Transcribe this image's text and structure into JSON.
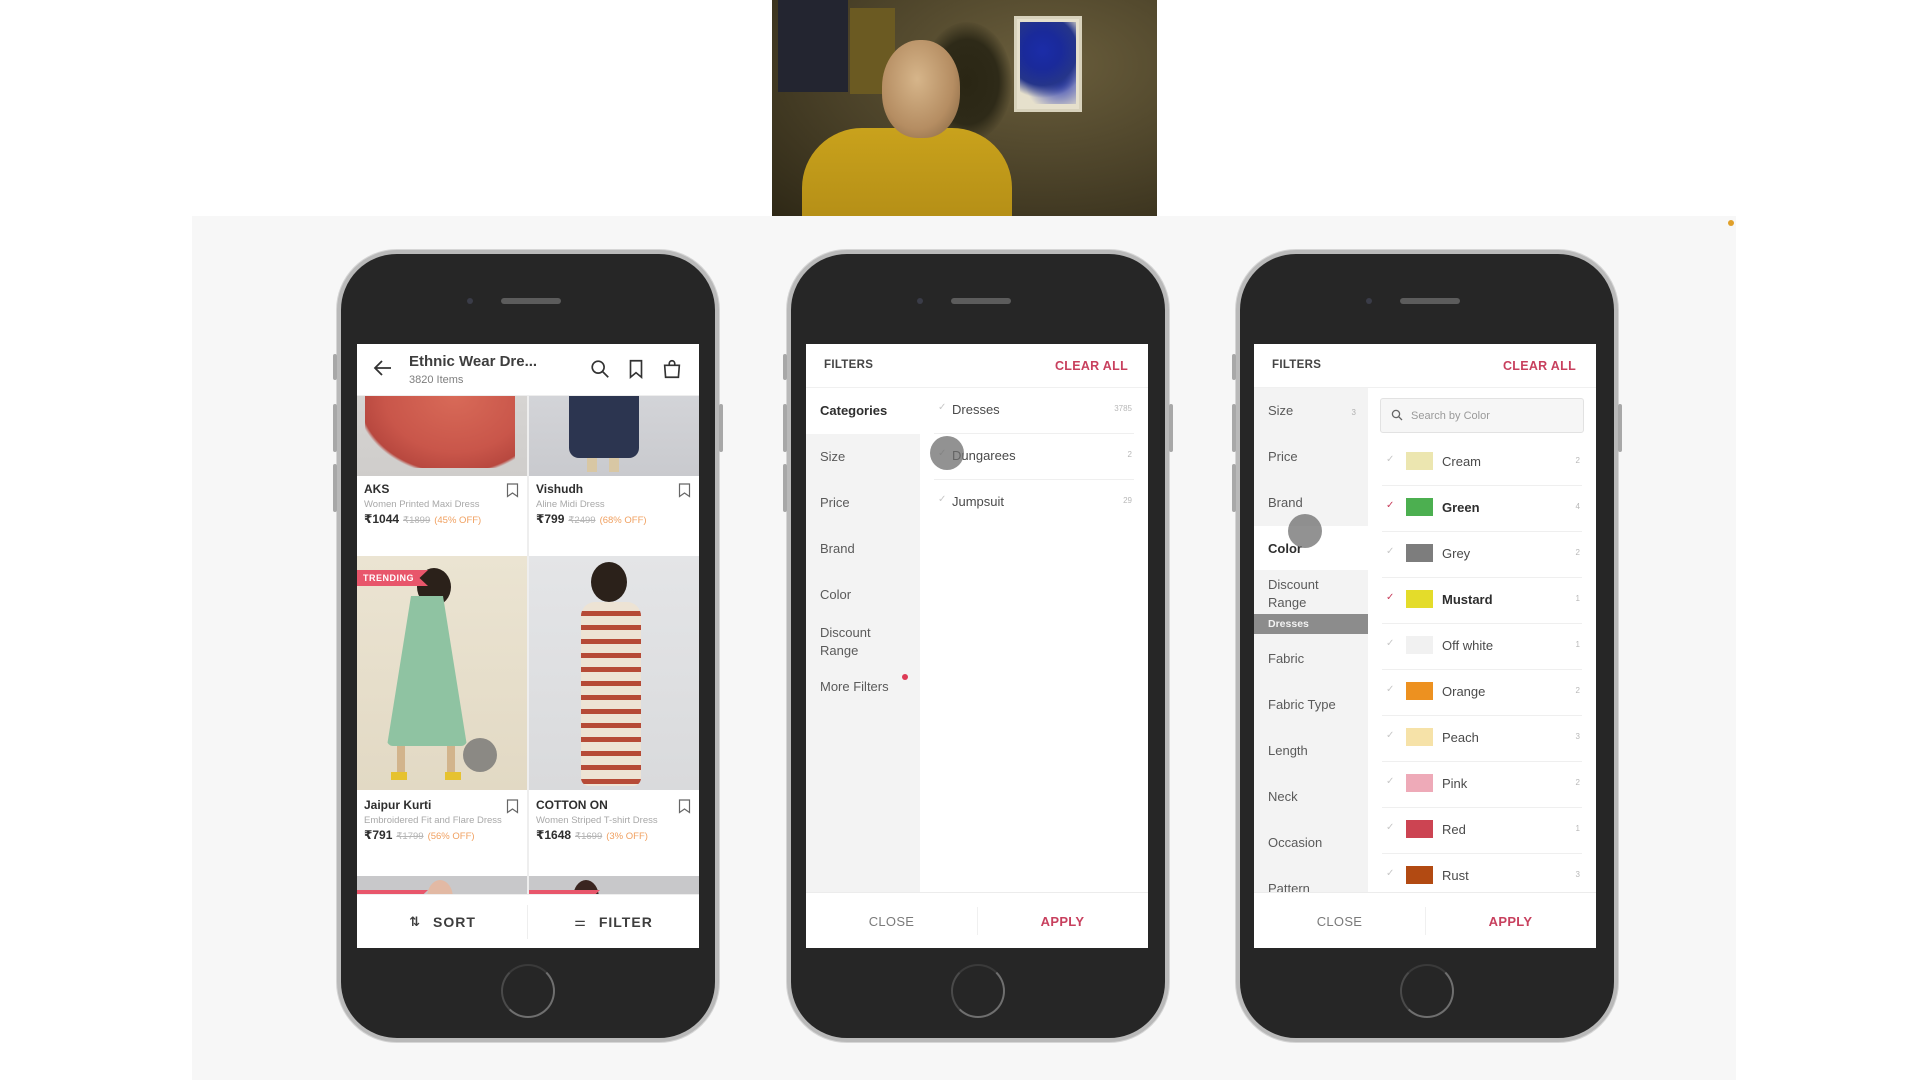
{
  "webcam": {
    "description": "presenter webcam feed"
  },
  "phone1": {
    "header": {
      "back_icon": "arrow-left-icon",
      "title": "Ethnic Wear Dre...",
      "subtitle": "3820 Items",
      "icons": [
        "search-icon",
        "bookmark-icon",
        "shopping-bag-icon"
      ]
    },
    "products": [
      {
        "brand": "AKS",
        "description": "Women Printed Maxi Dress",
        "price": "₹1044",
        "mrp": "₹1899",
        "discount": "(45% OFF)",
        "trending": false,
        "image_colors": [
          "#c9564a",
          "#d7d4d2"
        ]
      },
      {
        "brand": "Vishudh",
        "description": "Aline Midi Dress",
        "price": "₹799",
        "mrp": "₹2499",
        "discount": "(68% OFF)",
        "trending": false,
        "image_colors": [
          "#2c3550",
          "#cfcfd1"
        ]
      },
      {
        "brand": "Jaipur Kurti",
        "description": "Embroidered Fit and Flare Dress",
        "price": "₹791",
        "mrp": "₹1799",
        "discount": "(56% OFF)",
        "trending": true,
        "image_colors": [
          "#8fc3a2",
          "#e9e1cf"
        ]
      },
      {
        "brand": "COTTON ON",
        "description": "Women Striped T-shirt Dress",
        "price": "₹1648",
        "mrp": "₹1699",
        "discount": "(3% OFF)",
        "trending": false,
        "image_colors": [
          "#b64a36",
          "#ece3d6"
        ]
      }
    ],
    "trending_label": "TRENDING",
    "footer": {
      "sort_label": "SORT",
      "filter_label": "FILTER"
    }
  },
  "phone2": {
    "title": "FILTERS",
    "clear_all": "CLEAR ALL",
    "categories": [
      {
        "label": "Categories",
        "active": true
      },
      {
        "label": "Size"
      },
      {
        "label": "Price"
      },
      {
        "label": "Brand"
      },
      {
        "label": "Color"
      },
      {
        "label": "Discount Range"
      },
      {
        "label": "More Filters",
        "indicator": true
      }
    ],
    "options": [
      {
        "label": "Dresses",
        "count": "3785"
      },
      {
        "label": "Dungarees",
        "count": "2"
      },
      {
        "label": "Jumpsuit",
        "count": "29"
      }
    ],
    "close_label": "CLOSE",
    "apply_label": "APPLY"
  },
  "phone3": {
    "title": "FILTERS",
    "clear_all": "CLEAR ALL",
    "categories": [
      {
        "label": "Size",
        "count": "3"
      },
      {
        "label": "Price"
      },
      {
        "label": "Brand"
      },
      {
        "label": "Color",
        "active": true
      },
      {
        "label": "Discount Range"
      },
      {
        "label": "Fabric"
      },
      {
        "label": "Fabric Type"
      },
      {
        "label": "Length"
      },
      {
        "label": "Neck"
      },
      {
        "label": "Occasion"
      },
      {
        "label": "Pattern"
      }
    ],
    "section_tag": "Dresses",
    "search_placeholder": "Search by Color",
    "colors": [
      {
        "label": "Cream",
        "count": "2",
        "swatch": "#ece6b0",
        "checked": false
      },
      {
        "label": "Green",
        "count": "4",
        "swatch": "#4caf50",
        "checked": true
      },
      {
        "label": "Grey",
        "count": "2",
        "swatch": "#7d7d7d",
        "checked": false
      },
      {
        "label": "Mustard",
        "count": "1",
        "swatch": "#e4dc2a",
        "checked": true
      },
      {
        "label": "Off white",
        "count": "1",
        "swatch": "#f1f1f1",
        "checked": false
      },
      {
        "label": "Orange",
        "count": "2",
        "swatch": "#ed9120",
        "checked": false
      },
      {
        "label": "Peach",
        "count": "3",
        "swatch": "#f6e2a8",
        "checked": false
      },
      {
        "label": "Pink",
        "count": "2",
        "swatch": "#eeaab8",
        "checked": false
      },
      {
        "label": "Red",
        "count": "1",
        "swatch": "#cc4452",
        "checked": false
      },
      {
        "label": "Rust",
        "count": "3",
        "swatch": "#b24a12",
        "checked": false
      }
    ],
    "close_label": "CLOSE",
    "apply_label": "APPLY"
  },
  "colors": {
    "accent": "#c8405e",
    "trending": "#e8566b",
    "discount": "#f0a060"
  },
  "check_glyph": "✓"
}
